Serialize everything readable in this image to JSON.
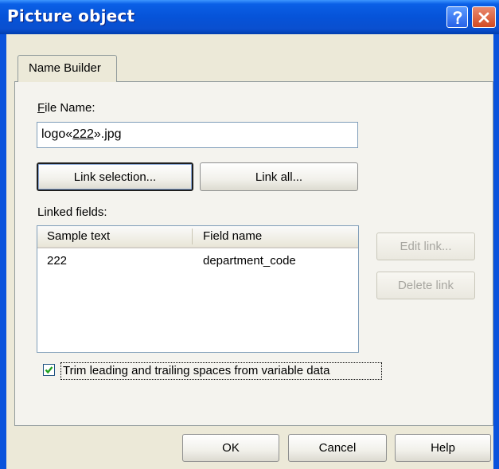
{
  "window": {
    "title": "Picture object"
  },
  "tabs": [
    {
      "label": "Name Builder"
    }
  ],
  "file_name": {
    "label": "File Name:",
    "value_prefix": "logo«",
    "value_link": "222",
    "value_suffix": "».jpg"
  },
  "buttons": {
    "link_selection": "Link selection...",
    "link_all": "Link all...",
    "edit_link": "Edit link...",
    "delete_link": "Delete link",
    "ok": "OK",
    "cancel": "Cancel",
    "help": "Help"
  },
  "linked_fields": {
    "label": "Linked fields:",
    "columns": [
      "Sample text",
      "Field name"
    ],
    "rows": [
      {
        "sample": "222",
        "field": "department_code"
      }
    ]
  },
  "trim_option": {
    "label": "Trim leading and trailing spaces from variable data",
    "checked": true
  },
  "colors": {
    "titlebar": "#0653d8",
    "dialog_face": "#ece9d8",
    "disabled_text": "#a7a6a0"
  }
}
